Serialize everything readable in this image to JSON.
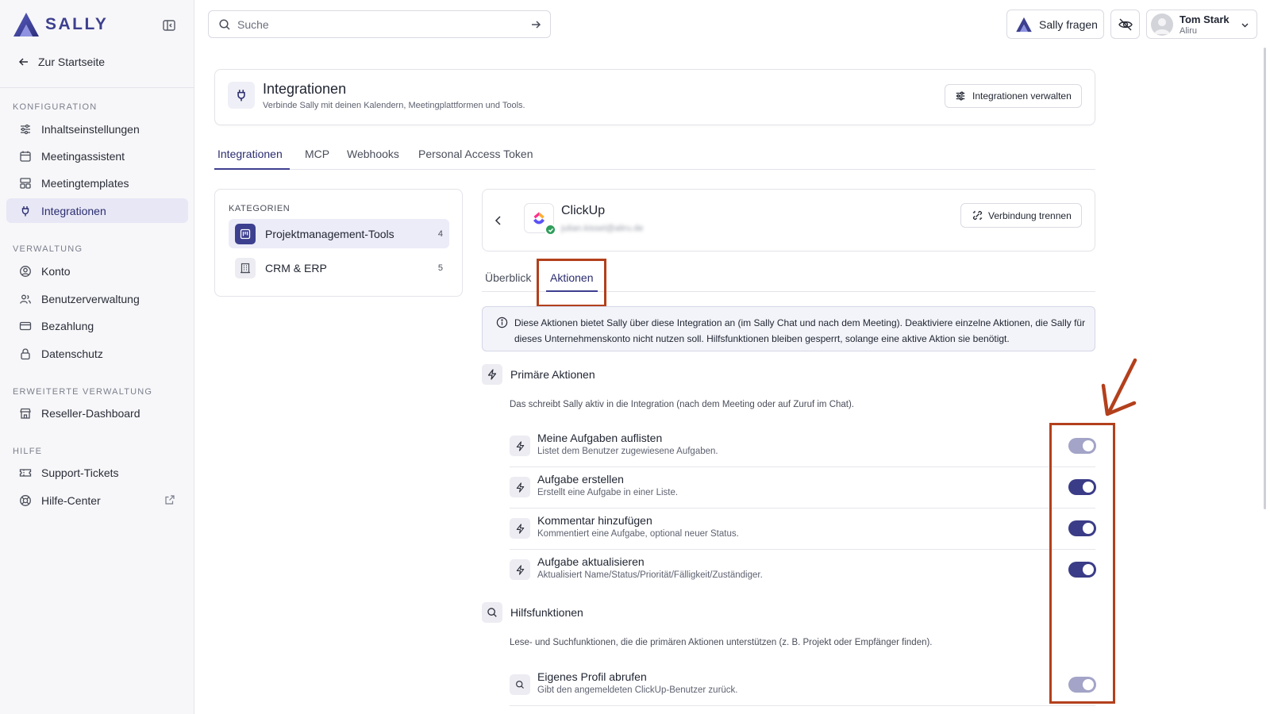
{
  "brand": {
    "name": "SALLY"
  },
  "sidebar": {
    "home_label": "Zur Startseite",
    "sections": [
      {
        "label": "KONFIGURATION",
        "items": [
          "Inhaltseinstellungen",
          "Meetingassistent",
          "Meetingtemplates",
          "Integrationen"
        ]
      },
      {
        "label": "VERWALTUNG",
        "items": [
          "Konto",
          "Benutzerverwaltung",
          "Bezahlung",
          "Datenschutz"
        ]
      },
      {
        "label": "ERWEITERTE VERWALTUNG",
        "items": [
          "Reseller-Dashboard"
        ]
      },
      {
        "label": "HILFE",
        "items": [
          "Support-Tickets",
          "Hilfe-Center"
        ]
      }
    ],
    "active_item": "Integrationen"
  },
  "header": {
    "search_placeholder": "Suche",
    "ask_label": "Sally fragen",
    "user": {
      "name": "Tom Stark",
      "org": "Aliru"
    }
  },
  "page": {
    "title": "Integrationen",
    "subtitle": "Verbinde Sally mit deinen Kalendern, Meetingplattformen und Tools.",
    "manage_label": "Integrationen verwalten",
    "tabs": [
      "Integrationen",
      "MCP",
      "Webhooks",
      "Personal Access Token"
    ],
    "active_tab": "Integrationen"
  },
  "categories": {
    "label": "KATEGORIEN",
    "items": [
      {
        "label": "Projektmanagement-Tools",
        "count": "4"
      },
      {
        "label": "CRM & ERP",
        "count": "5"
      }
    ]
  },
  "integration": {
    "name": "ClickUp",
    "email": "julian.kissel@aliru.de",
    "disconnect_label": "Verbindung trennen",
    "subtabs": [
      "Überblick",
      "Aktionen"
    ],
    "active_subtab": "Aktionen",
    "info": "Diese Aktionen bietet Sally über diese Integration an (im Sally Chat und nach dem Meeting). Deaktiviere einzelne Aktionen, die Sally für dieses Unternehmenskonto nicht nutzen soll. Hilfsfunktionen bleiben gesperrt, solange eine aktive Aktion sie benötigt.",
    "primary": {
      "title": "Primäre Aktionen",
      "desc": "Das schreibt Sally aktiv in die Integration (nach dem Meeting oder auf Zuruf im Chat).",
      "actions": [
        {
          "title": "Meine Aufgaben auflisten",
          "desc": "Listet dem Benutzer zugewiesene Aufgaben.",
          "enabled": true,
          "locked": true
        },
        {
          "title": "Aufgabe erstellen",
          "desc": "Erstellt eine Aufgabe in einer Liste.",
          "enabled": true,
          "locked": false
        },
        {
          "title": "Kommentar hinzufügen",
          "desc": "Kommentiert eine Aufgabe, optional neuer Status.",
          "enabled": true,
          "locked": false
        },
        {
          "title": "Aufgabe aktualisieren",
          "desc": "Aktualisiert Name/Status/Priorität/Fälligkeit/Zuständiger.",
          "enabled": true,
          "locked": false
        }
      ]
    },
    "helpers": {
      "title": "Hilfsfunktionen",
      "desc": "Lese- und Suchfunktionen, die die primären Aktionen unterstützen (z. B. Projekt oder Empfänger finden).",
      "actions": [
        {
          "title": "Eigenes Profil abrufen",
          "desc": "Gibt den angemeldeten ClickUp-Benutzer zurück.",
          "enabled": true,
          "locked": true
        }
      ]
    }
  },
  "colors": {
    "accent": "#3a3c87",
    "highlight": "#b3401c",
    "success": "#2e9e5b"
  }
}
